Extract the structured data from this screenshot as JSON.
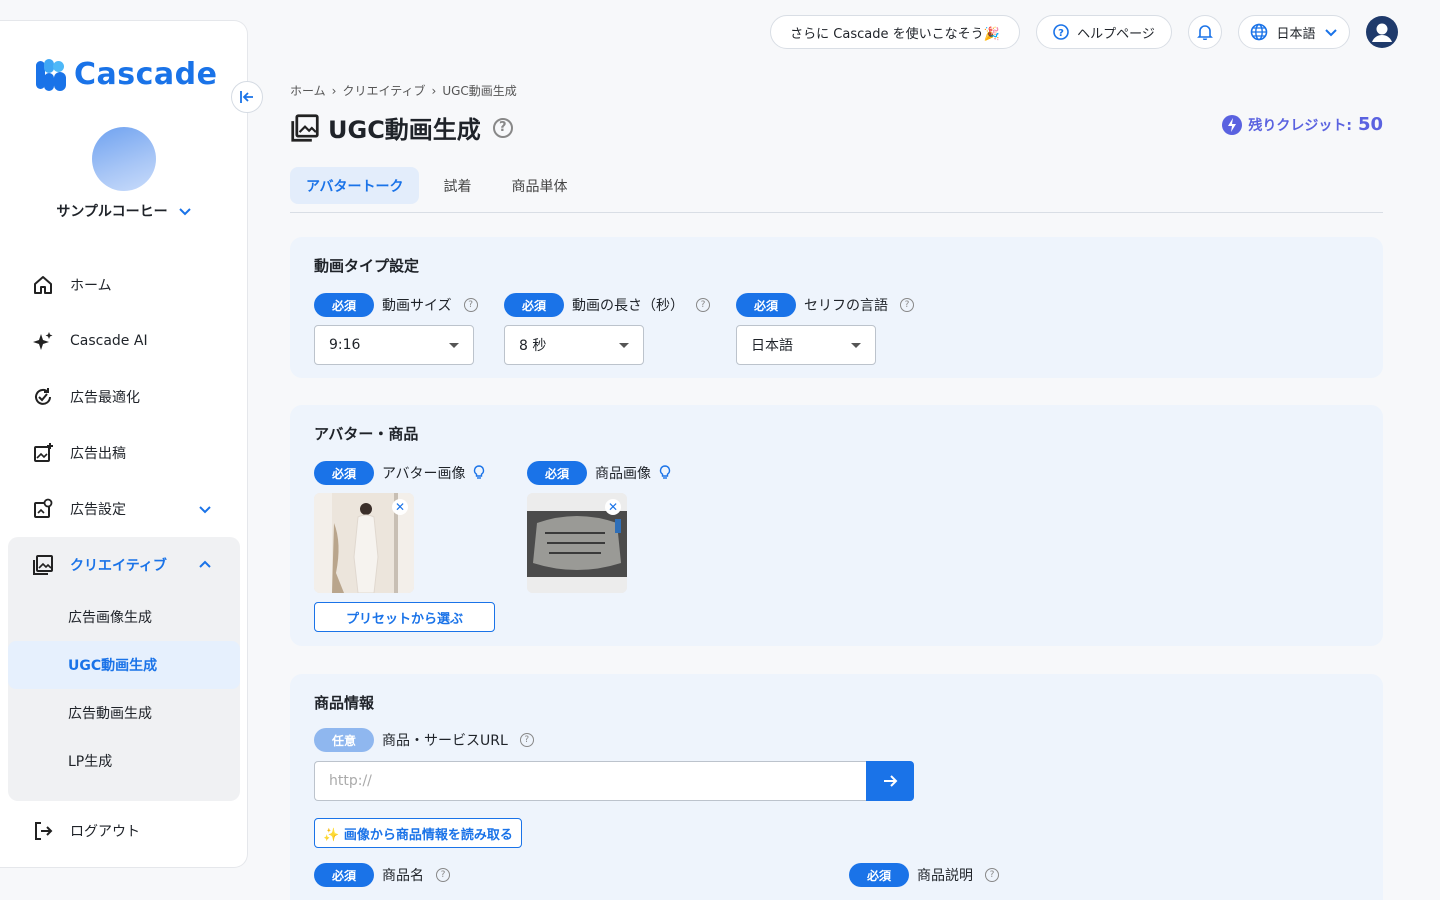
{
  "app": {
    "name": "Cascade"
  },
  "colors": {
    "primary": "#1a73e8",
    "credit": "#5a62e0"
  },
  "sidebar": {
    "company": "サンプルコーヒー",
    "items": [
      {
        "label": "ホーム",
        "icon": "home-icon"
      },
      {
        "label": "Cascade AI",
        "icon": "sparkle-icon"
      },
      {
        "label": "広告最適化",
        "icon": "optimize-icon"
      },
      {
        "label": "広告出稿",
        "icon": "publish-icon"
      },
      {
        "label": "広告設定",
        "icon": "settings-icon"
      }
    ],
    "creative": {
      "label": "クリエイティブ",
      "sub": [
        "広告画像生成",
        "UGC動画生成",
        "広告動画生成",
        "LP生成"
      ]
    },
    "logout": "ログアウト"
  },
  "header": {
    "promo": "さらに Cascade を使いこなそう🎉",
    "help": "ヘルプページ",
    "language": "日本語"
  },
  "breadcrumb": [
    "ホーム",
    "クリエイティブ",
    "UGC動画生成"
  ],
  "page": {
    "title": "UGC動画生成"
  },
  "credits": {
    "label": "残りクレジット:",
    "value": "50"
  },
  "tabs": [
    "アバタートーク",
    "試着",
    "商品単体"
  ],
  "video_type": {
    "title": "動画タイプ設定",
    "required": "必須",
    "size": {
      "label": "動画サイズ",
      "value": "9:16"
    },
    "length": {
      "label": "動画の長さ（秒）",
      "value": "8 秒"
    },
    "lang": {
      "label": "セリフの言語",
      "value": "日本語"
    }
  },
  "avatar_product": {
    "title": "アバター・商品",
    "avatar_label": "アバター画像",
    "product_label": "商品画像",
    "preset_button": "プリセットから選ぶ"
  },
  "product_info": {
    "title": "商品情報",
    "optional": "任意",
    "url_label": "商品・サービスURL",
    "url_placeholder": "http://",
    "read_button": "✨ 画像から商品情報を読み取る",
    "name_label": "商品名",
    "desc_label": "商品説明"
  }
}
